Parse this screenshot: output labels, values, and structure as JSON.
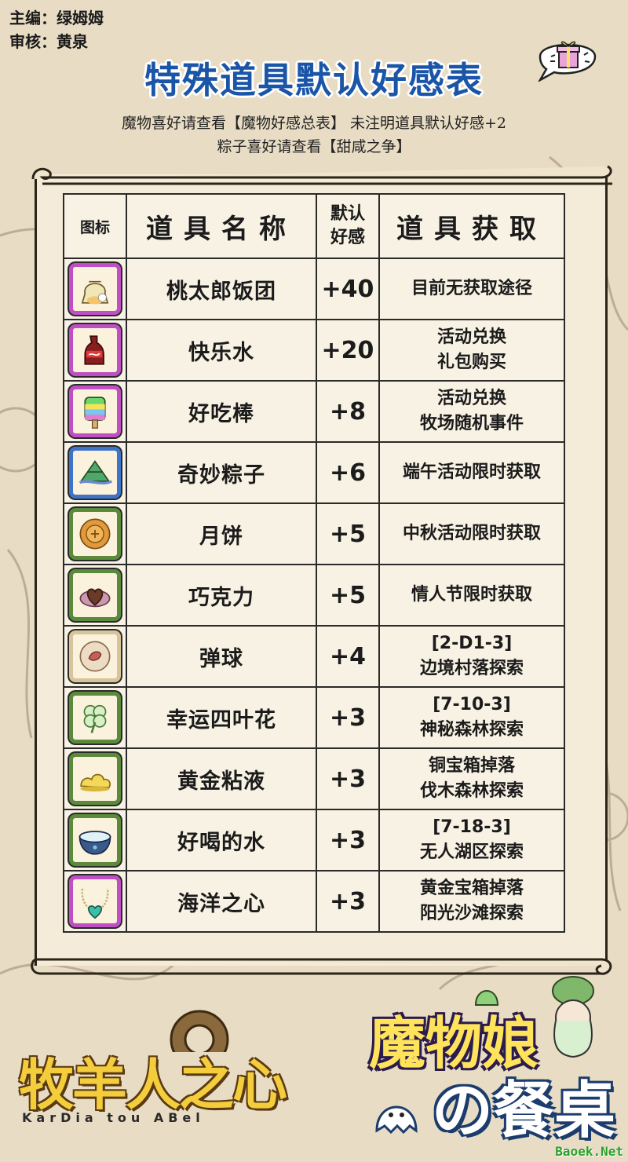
{
  "credits": {
    "editor": "主编：绿姆姆",
    "reviewer": "审核：黄泉"
  },
  "title": "特殊道具默认好感表",
  "notes": {
    "line1": "魔物喜好请查看【魔物好感总表】 未注明道具默认好感+2",
    "line2": "粽子喜好请查看【甜咸之争】"
  },
  "table": {
    "headers": {
      "icon": "图标",
      "name": "道具名称",
      "value_line1": "默认",
      "value_line2": "好感",
      "obtain": "道具获取"
    },
    "rows": [
      {
        "icon": "rice-ball-bag-icon",
        "frame": "#c04fc4",
        "name": "桃太郎饭团",
        "value": "+40",
        "obtain": [
          "目前无获取途径"
        ]
      },
      {
        "icon": "soda-bottle-icon",
        "frame": "#c04fc4",
        "name": "快乐水",
        "value": "+20",
        "obtain": [
          "活动兑换",
          "礼包购买"
        ]
      },
      {
        "icon": "popsicle-icon",
        "frame": "#c04fc4",
        "name": "好吃棒",
        "value": "+8",
        "obtain": [
          "活动兑换",
          "牧场随机事件"
        ]
      },
      {
        "icon": "zongzi-icon",
        "frame": "#3e74c7",
        "name": "奇妙粽子",
        "value": "+6",
        "obtain": [
          "端午活动限时获取"
        ]
      },
      {
        "icon": "mooncake-icon",
        "frame": "#5a8a3a",
        "name": "月饼",
        "value": "+5",
        "obtain": [
          "中秋活动限时获取"
        ]
      },
      {
        "icon": "chocolate-icon",
        "frame": "#5a8a3a",
        "name": "巧克力",
        "value": "+5",
        "obtain": [
          "情人节限时获取"
        ]
      },
      {
        "icon": "marble-icon",
        "frame": "#d8c49a",
        "name": "弹球",
        "value": "+4",
        "obtain": [
          "[2-D1-3]",
          "边境村落探索"
        ]
      },
      {
        "icon": "clover-icon",
        "frame": "#5a8a3a",
        "name": "幸运四叶花",
        "value": "+3",
        "obtain": [
          "[7-10-3]",
          "神秘森林探索"
        ]
      },
      {
        "icon": "gold-slime-icon",
        "frame": "#5a8a3a",
        "name": "黄金粘液",
        "value": "+3",
        "obtain": [
          "铜宝箱掉落",
          "伐木森林探索"
        ]
      },
      {
        "icon": "water-bowl-icon",
        "frame": "#5a8a3a",
        "name": "好喝的水",
        "value": "+3",
        "obtain": [
          "[7-18-3]",
          "无人湖区探索"
        ]
      },
      {
        "icon": "ocean-heart-necklace-icon",
        "frame": "#c04fc4",
        "name": "海洋之心",
        "value": "+3",
        "obtain": [
          "黄金宝箱掉落",
          "阳光沙滩探索"
        ]
      }
    ]
  },
  "logos": {
    "left_main": "牧羊人之心",
    "left_sub": "KarDia tou ABel",
    "right_line1": "魔物娘",
    "right_line2": "の餐桌"
  },
  "watermark": "Baoek.Net"
}
